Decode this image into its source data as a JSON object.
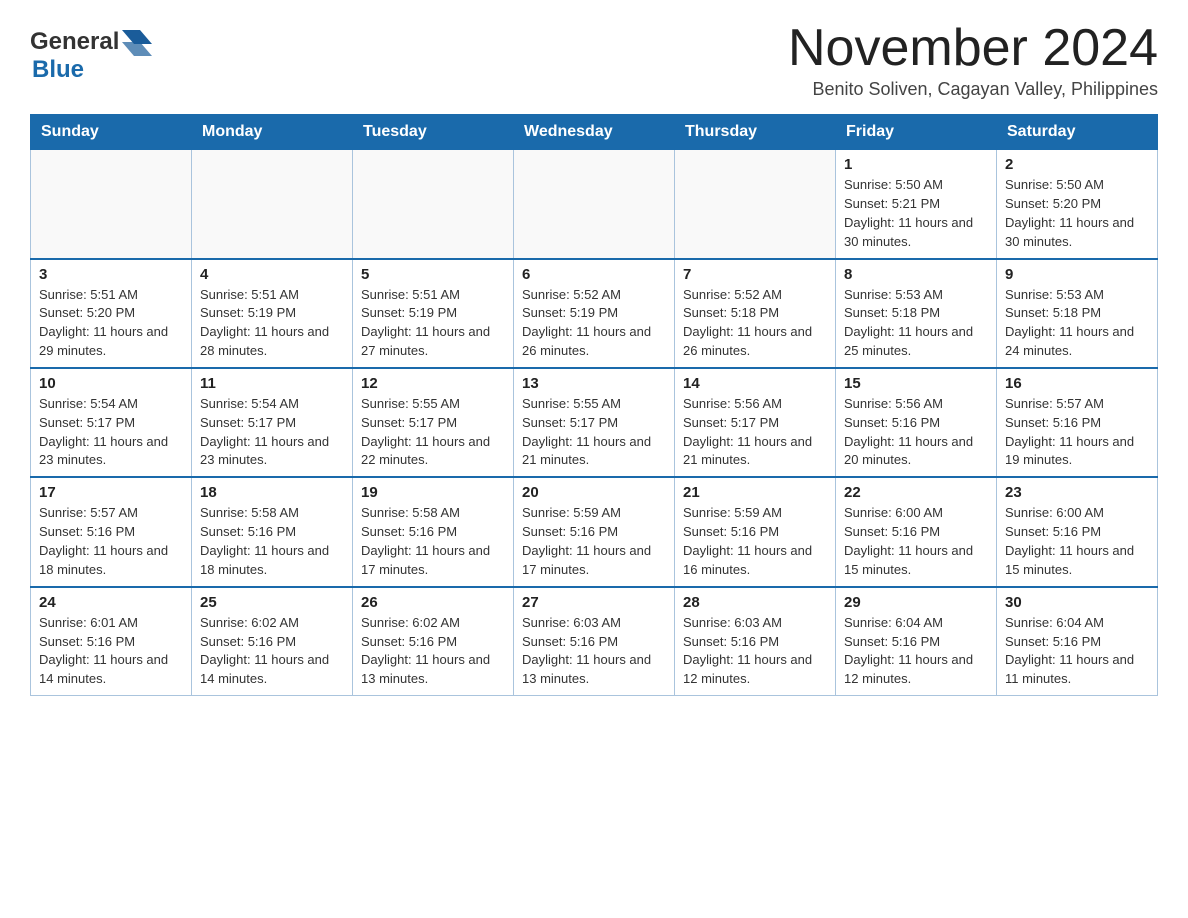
{
  "logo": {
    "text_general": "General",
    "text_blue": "Blue"
  },
  "title": "November 2024",
  "location": "Benito Soliven, Cagayan Valley, Philippines",
  "weekdays": [
    "Sunday",
    "Monday",
    "Tuesday",
    "Wednesday",
    "Thursday",
    "Friday",
    "Saturday"
  ],
  "rows": [
    [
      {
        "day": "",
        "info": ""
      },
      {
        "day": "",
        "info": ""
      },
      {
        "day": "",
        "info": ""
      },
      {
        "day": "",
        "info": ""
      },
      {
        "day": "",
        "info": ""
      },
      {
        "day": "1",
        "info": "Sunrise: 5:50 AM\nSunset: 5:21 PM\nDaylight: 11 hours and 30 minutes."
      },
      {
        "day": "2",
        "info": "Sunrise: 5:50 AM\nSunset: 5:20 PM\nDaylight: 11 hours and 30 minutes."
      }
    ],
    [
      {
        "day": "3",
        "info": "Sunrise: 5:51 AM\nSunset: 5:20 PM\nDaylight: 11 hours and 29 minutes."
      },
      {
        "day": "4",
        "info": "Sunrise: 5:51 AM\nSunset: 5:19 PM\nDaylight: 11 hours and 28 minutes."
      },
      {
        "day": "5",
        "info": "Sunrise: 5:51 AM\nSunset: 5:19 PM\nDaylight: 11 hours and 27 minutes."
      },
      {
        "day": "6",
        "info": "Sunrise: 5:52 AM\nSunset: 5:19 PM\nDaylight: 11 hours and 26 minutes."
      },
      {
        "day": "7",
        "info": "Sunrise: 5:52 AM\nSunset: 5:18 PM\nDaylight: 11 hours and 26 minutes."
      },
      {
        "day": "8",
        "info": "Sunrise: 5:53 AM\nSunset: 5:18 PM\nDaylight: 11 hours and 25 minutes."
      },
      {
        "day": "9",
        "info": "Sunrise: 5:53 AM\nSunset: 5:18 PM\nDaylight: 11 hours and 24 minutes."
      }
    ],
    [
      {
        "day": "10",
        "info": "Sunrise: 5:54 AM\nSunset: 5:17 PM\nDaylight: 11 hours and 23 minutes."
      },
      {
        "day": "11",
        "info": "Sunrise: 5:54 AM\nSunset: 5:17 PM\nDaylight: 11 hours and 23 minutes."
      },
      {
        "day": "12",
        "info": "Sunrise: 5:55 AM\nSunset: 5:17 PM\nDaylight: 11 hours and 22 minutes."
      },
      {
        "day": "13",
        "info": "Sunrise: 5:55 AM\nSunset: 5:17 PM\nDaylight: 11 hours and 21 minutes."
      },
      {
        "day": "14",
        "info": "Sunrise: 5:56 AM\nSunset: 5:17 PM\nDaylight: 11 hours and 21 minutes."
      },
      {
        "day": "15",
        "info": "Sunrise: 5:56 AM\nSunset: 5:16 PM\nDaylight: 11 hours and 20 minutes."
      },
      {
        "day": "16",
        "info": "Sunrise: 5:57 AM\nSunset: 5:16 PM\nDaylight: 11 hours and 19 minutes."
      }
    ],
    [
      {
        "day": "17",
        "info": "Sunrise: 5:57 AM\nSunset: 5:16 PM\nDaylight: 11 hours and 18 minutes."
      },
      {
        "day": "18",
        "info": "Sunrise: 5:58 AM\nSunset: 5:16 PM\nDaylight: 11 hours and 18 minutes."
      },
      {
        "day": "19",
        "info": "Sunrise: 5:58 AM\nSunset: 5:16 PM\nDaylight: 11 hours and 17 minutes."
      },
      {
        "day": "20",
        "info": "Sunrise: 5:59 AM\nSunset: 5:16 PM\nDaylight: 11 hours and 17 minutes."
      },
      {
        "day": "21",
        "info": "Sunrise: 5:59 AM\nSunset: 5:16 PM\nDaylight: 11 hours and 16 minutes."
      },
      {
        "day": "22",
        "info": "Sunrise: 6:00 AM\nSunset: 5:16 PM\nDaylight: 11 hours and 15 minutes."
      },
      {
        "day": "23",
        "info": "Sunrise: 6:00 AM\nSunset: 5:16 PM\nDaylight: 11 hours and 15 minutes."
      }
    ],
    [
      {
        "day": "24",
        "info": "Sunrise: 6:01 AM\nSunset: 5:16 PM\nDaylight: 11 hours and 14 minutes."
      },
      {
        "day": "25",
        "info": "Sunrise: 6:02 AM\nSunset: 5:16 PM\nDaylight: 11 hours and 14 minutes."
      },
      {
        "day": "26",
        "info": "Sunrise: 6:02 AM\nSunset: 5:16 PM\nDaylight: 11 hours and 13 minutes."
      },
      {
        "day": "27",
        "info": "Sunrise: 6:03 AM\nSunset: 5:16 PM\nDaylight: 11 hours and 13 minutes."
      },
      {
        "day": "28",
        "info": "Sunrise: 6:03 AM\nSunset: 5:16 PM\nDaylight: 11 hours and 12 minutes."
      },
      {
        "day": "29",
        "info": "Sunrise: 6:04 AM\nSunset: 5:16 PM\nDaylight: 11 hours and 12 minutes."
      },
      {
        "day": "30",
        "info": "Sunrise: 6:04 AM\nSunset: 5:16 PM\nDaylight: 11 hours and 11 minutes."
      }
    ]
  ]
}
